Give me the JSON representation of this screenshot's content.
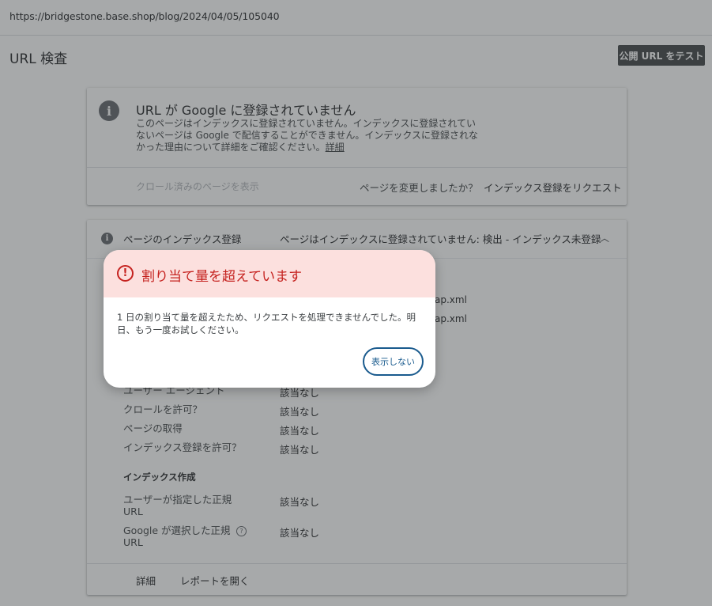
{
  "url": "https://bridgestone.base.shop/blog/2024/04/05/105040",
  "header": {
    "title": "URL 検査",
    "test_button": "公開 URL をテスト"
  },
  "status_card": {
    "title": "URL が Google に登録されていません",
    "desc_line1": "このページはインデックスに登録されていません。インデックスに登録されてい",
    "desc_line2": "ないページは Google で配信することができません。インデックスに登録されな",
    "desc_line3": "かった理由について詳細をご確認ください。",
    "details_link": "詳細",
    "crawled_link": "クロール済みのページを表示",
    "changed_question": "ページを変更しましたか？",
    "request_index": "インデックス登録をリクエスト"
  },
  "index_card": {
    "label": "ページのインデックス登録",
    "status": "ページはインデックスに登録されていません: 検出 - インデックス未登録",
    "sitemap_fragment_1": "ap.xml",
    "sitemap_fragment_2": "ap.xml",
    "rows": [
      {
        "label": "ユーザー エージェント",
        "value": "該当なし"
      },
      {
        "label": "クロールを許可？",
        "value": "該当なし"
      },
      {
        "label": "ページの取得",
        "value": "該当なし"
      },
      {
        "label": "インデックス登録を許可？",
        "value": "該当なし"
      }
    ],
    "section_heading": "インデックス作成",
    "canon_rows": [
      {
        "label_line1": "ユーザーが指定した正規",
        "label_line2": "URL",
        "value": "該当なし"
      },
      {
        "label_line1": "Google が選択した正規",
        "label_line2": "URL",
        "value": "該当なし"
      }
    ],
    "footer": {
      "details": "詳細",
      "open_report": "レポートを開く"
    }
  },
  "modal": {
    "title": "割り当て量を超えています",
    "body": "1 日の割り当て量を超えたため、リクエストを処理できませんでした。明日、もう一度お試しください。",
    "dismiss": "表示しない"
  },
  "colors": {
    "modal_header_bg": "#fce0de",
    "error_red": "#c5221f",
    "button_blue": "#1a5b8e",
    "overlay": "rgba(60,64,67,0.45)"
  },
  "icons": {
    "status": "info-icon",
    "index": "info-icon",
    "help": "help-icon",
    "alert": "alert-circle-icon",
    "chevron": "chevron-up-icon"
  }
}
